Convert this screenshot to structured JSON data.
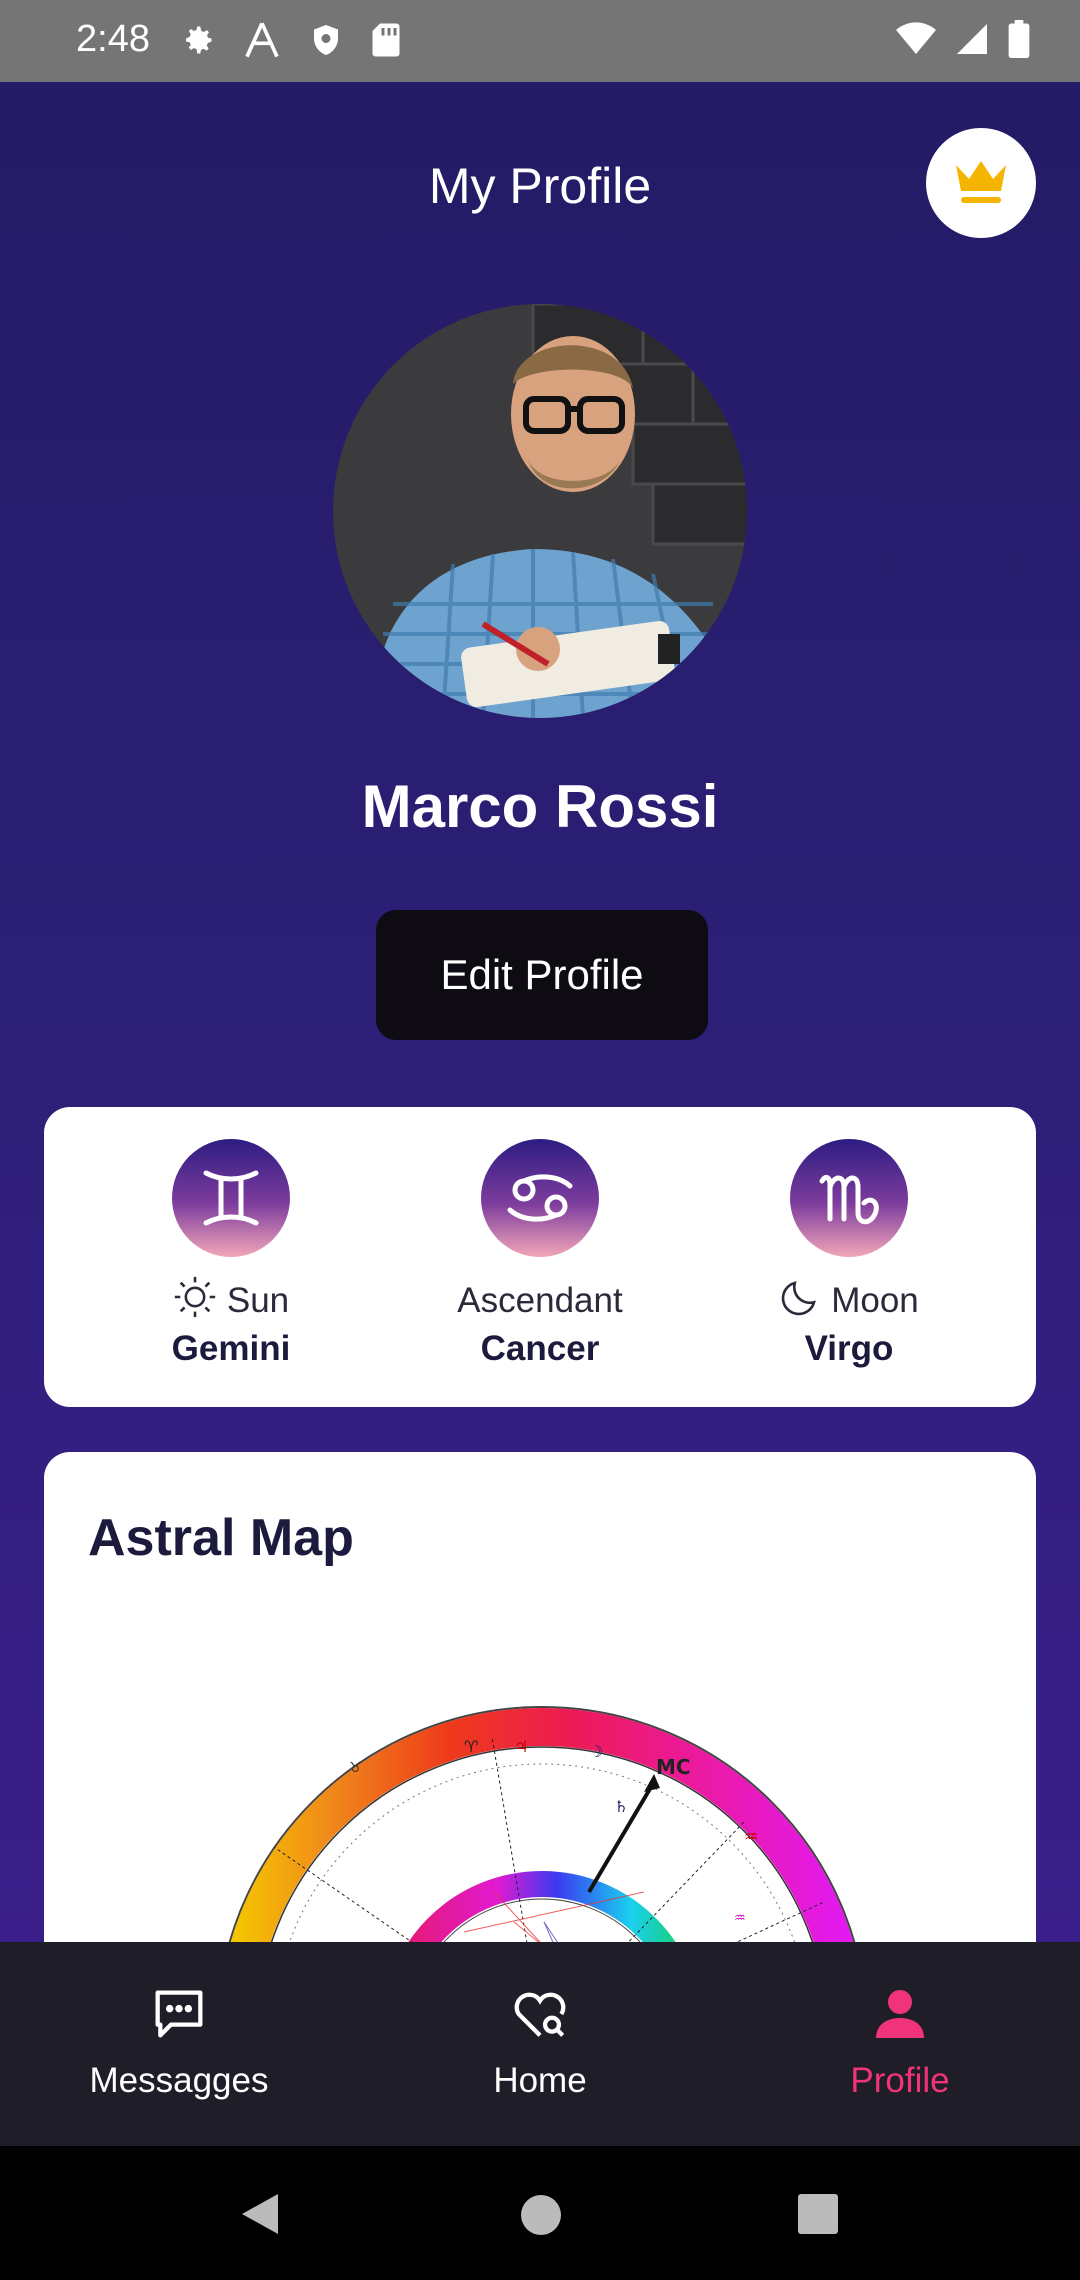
{
  "status_bar": {
    "time": "2:48"
  },
  "header": {
    "title": "My Profile"
  },
  "user": {
    "name": "Marco Rossi"
  },
  "actions": {
    "edit_profile": "Edit Profile"
  },
  "signs": [
    {
      "label": "Sun",
      "value": "Gemini",
      "glyph": "♊"
    },
    {
      "label": "Ascendant",
      "value": "Cancer",
      "glyph": "♋"
    },
    {
      "label": "Moon",
      "value": "Virgo",
      "glyph": "♍"
    }
  ],
  "astral_map": {
    "title": "Astral Map"
  },
  "nav": {
    "items": [
      {
        "label": "Messagges",
        "icon": "chat-bubble-icon"
      },
      {
        "label": "Home",
        "icon": "heart-search-icon"
      },
      {
        "label": "Profile",
        "icon": "person-icon"
      }
    ],
    "active": "Profile"
  },
  "colors": {
    "accent": "#f0337a",
    "crown": "#f5b400",
    "background": "#2a1f6b"
  }
}
